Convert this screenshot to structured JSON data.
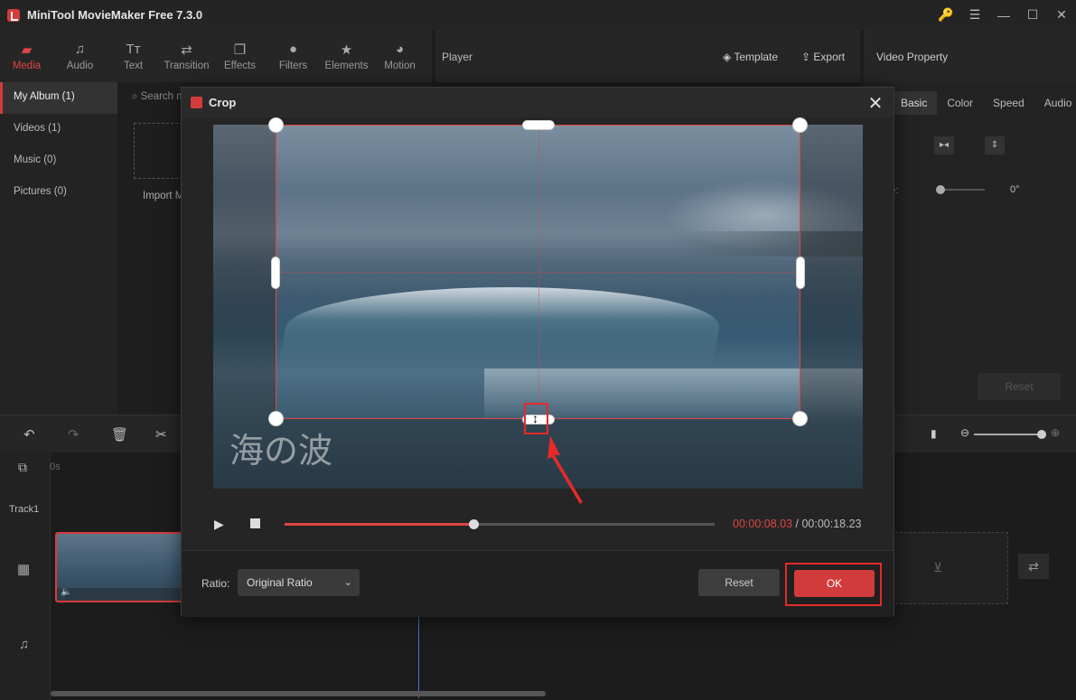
{
  "app": {
    "title": "MiniTool MovieMaker Free 7.3.0"
  },
  "window_controls": {
    "key": "🔑",
    "menu": "☰",
    "minimize": "—",
    "maximize": "☐",
    "close": "✕"
  },
  "toolbar": {
    "tabs": [
      {
        "label": "Media",
        "icon": "▰"
      },
      {
        "label": "Audio",
        "icon": "♫"
      },
      {
        "label": "Text",
        "icon": "Tт"
      },
      {
        "label": "Transition",
        "icon": "⇄"
      },
      {
        "label": "Effects",
        "icon": "❐"
      },
      {
        "label": "Filters",
        "icon": "●"
      },
      {
        "label": "Elements",
        "icon": "★"
      },
      {
        "label": "Motion",
        "icon": "◕"
      }
    ]
  },
  "player_bar": {
    "label": "Player",
    "template": "Template",
    "export": "Export"
  },
  "property_bar": {
    "label": "Video Property"
  },
  "sidebar": {
    "items": [
      "My Album (1)",
      "Videos (1)",
      "Music (0)",
      "Pictures (0)"
    ]
  },
  "media": {
    "search": "Search m",
    "import": "Import M"
  },
  "property": {
    "tabs": [
      "Basic",
      "Color",
      "Speed",
      "Audio"
    ],
    "flip_label": "p:",
    "rotate_label": "tate:",
    "rotate_value": "0°",
    "reset": "Reset"
  },
  "timeline": {
    "ruler_start": "0s",
    "track_label": "Track1"
  },
  "crop_dialog": {
    "title": "Crop",
    "close": "✕",
    "watermark": "海の波",
    "current_time": "00:00:08.03",
    "separator": " / ",
    "total_time": "00:00:18.23",
    "progress": 0.44,
    "ratio_label": "Ratio:",
    "ratio_value": "Original Ratio",
    "reset": "Reset",
    "ok": "OK"
  }
}
